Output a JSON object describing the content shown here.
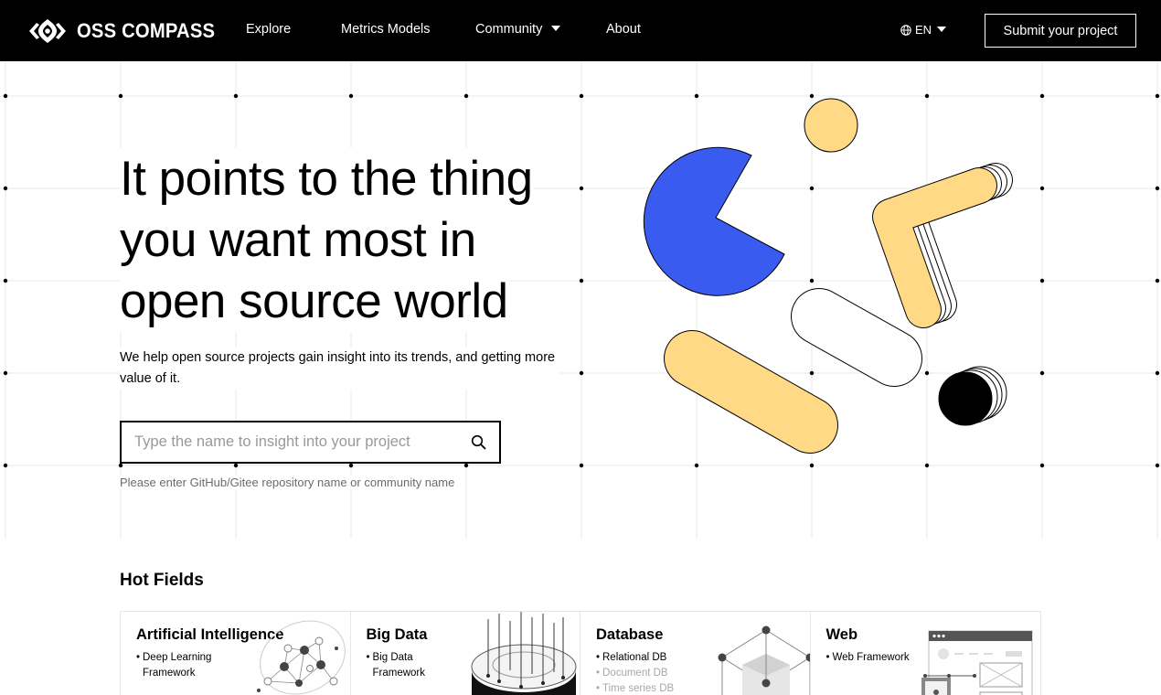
{
  "nav": {
    "brand": "OSS COMPASS",
    "items": [
      {
        "label": "Explore"
      },
      {
        "label": "Metrics Models"
      },
      {
        "label": "Community"
      },
      {
        "label": "About"
      }
    ],
    "lang": "EN",
    "submit_label": "Submit your project",
    "icons": {
      "logo": "compass-logo-icon",
      "lang": "globe-icon",
      "dropdown": "caret-down-icon"
    }
  },
  "hero": {
    "headline": [
      "It points to the thing",
      "you want most in",
      "open source world"
    ],
    "subtext": "We help open source projects gain insight into its trends, and getting more value of it.",
    "search": {
      "placeholder": "Type the name to insight into your project",
      "value": ""
    },
    "hint": "Please enter GitHub/Gitee repository name or community name",
    "colors": {
      "blue": "#3A5BEF",
      "yellow": "#FFD986",
      "black": "#000000"
    }
  },
  "hot_fields": {
    "title": "Hot Fields",
    "cards": [
      {
        "title": "Artificial Intelligence",
        "items": [
          {
            "label": "Deep Learning Framework",
            "muted": false
          }
        ]
      },
      {
        "title": "Big Data",
        "items": [
          {
            "label": "Big Data Framework",
            "muted": false
          }
        ]
      },
      {
        "title": "Database",
        "items": [
          {
            "label": "Relational DB",
            "muted": false
          },
          {
            "label": "Document DB",
            "muted": true
          },
          {
            "label": "Time series DB",
            "muted": true
          }
        ]
      },
      {
        "title": "Web",
        "items": [
          {
            "label": "Web Framework",
            "muted": false
          }
        ]
      }
    ]
  }
}
